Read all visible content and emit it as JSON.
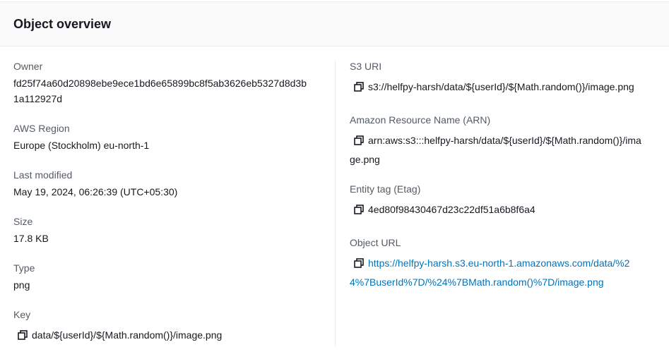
{
  "header": {
    "title": "Object overview"
  },
  "left": {
    "owner": {
      "label": "Owner",
      "value_line1": "fd25f74a60d20898ebe9ece1bd6e65899bc8f5ab3626eb5327d8d3b",
      "value_line2": "1a112927d"
    },
    "region": {
      "label": "AWS Region",
      "value": "Europe (Stockholm) eu-north-1"
    },
    "last_modified": {
      "label": "Last modified",
      "value": "May 19, 2024, 06:26:39 (UTC+05:30)"
    },
    "size": {
      "label": "Size",
      "value": "17.8 KB"
    },
    "type": {
      "label": "Type",
      "value": "png"
    },
    "key": {
      "label": "Key",
      "value": "data/${userId}/${Math.random()}/image.png",
      "icon": "copy-icon"
    }
  },
  "right": {
    "s3_uri": {
      "label": "S3 URI",
      "value": "s3://helfpy-harsh/data/${userId}/${Math.random()}/image.png",
      "icon": "copy-icon"
    },
    "arn": {
      "label": "Amazon Resource Name (ARN)",
      "value_line1": "arn:aws:s3:::helfpy-harsh/data/${userId}/${Math.random()}/ima",
      "value_line2": "ge.png",
      "icon": "copy-icon"
    },
    "etag": {
      "label": "Entity tag (Etag)",
      "value": "4ed80f98430467d23c22df51a6b8f6a4",
      "icon": "copy-icon"
    },
    "object_url": {
      "label": "Object URL",
      "value_line1": "https://helfpy-harsh.s3.eu-north-1.amazonaws.com/data/%2",
      "value_line2": "4%7BuserId%7D/%24%7BMath.random()%7D/image.png",
      "icon": "copy-icon"
    }
  },
  "colors": {
    "label": "#545b64",
    "value": "#16191f",
    "link": "#0073bb",
    "header_bg": "#fafafa",
    "border": "#eaeded"
  }
}
